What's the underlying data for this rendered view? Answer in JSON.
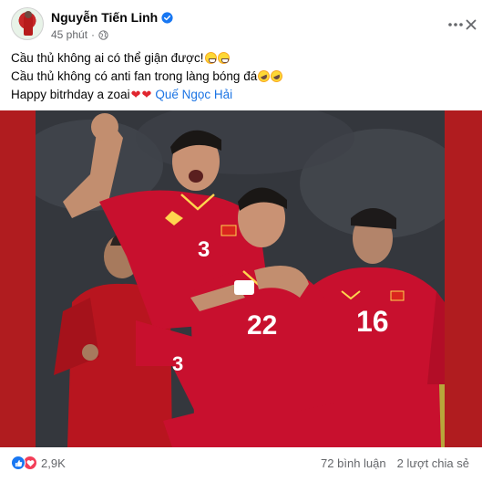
{
  "post": {
    "author": "Nguyễn Tiến Linh",
    "time": "45 phút",
    "separator": "·",
    "caption": {
      "line1": "Cầu thủ không ai có thể giận được!",
      "line2": "Cầu thủ không có anti fan trong làng bóng đá",
      "line3": "Happy bitrhday a zoai",
      "mention": "Quế Ngọc Hải"
    },
    "photo": {
      "jersey_numbers": [
        "3",
        "22",
        "16",
        "3"
      ]
    },
    "stats": {
      "reactions": "2,9K",
      "comments": "72 bình luận",
      "shares": "2 lượt chia sẻ"
    }
  },
  "icons": {
    "verified": "verified-badge-icon",
    "audience": "globe-icon",
    "more": "more-dots-icon",
    "close": "close-icon",
    "like": "like-reaction-icon",
    "love": "love-reaction-icon"
  },
  "colors": {
    "link": "#1b74e4",
    "secondary_text": "#65676b",
    "jersey_red": "#c8102e",
    "photo_border": "#b01c1f",
    "like_blue": "#1877f2",
    "love_red": "#f33e58"
  }
}
